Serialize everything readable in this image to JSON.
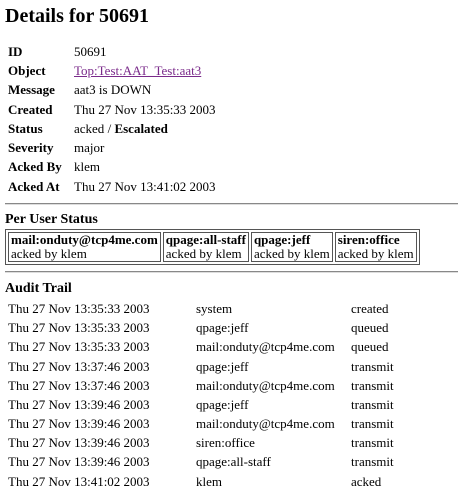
{
  "title": "Details for 50691",
  "details": [
    {
      "label": "ID",
      "value": "50691"
    },
    {
      "label": "Object",
      "value": "Top:Test:AAT_Test:aat3"
    },
    {
      "label": "Message",
      "value": "aat3 is DOWN"
    },
    {
      "label": "Created",
      "value": "Thu 27 Nov 13:35:33 2003"
    },
    {
      "label": "Status",
      "value": "acked",
      "sep": " / ",
      "extra": "Escalated"
    },
    {
      "label": "Severity",
      "value": "major"
    },
    {
      "label": "Acked By",
      "value": "klem"
    },
    {
      "label": "Acked At",
      "value": "Thu 27 Nov 13:41:02 2003"
    }
  ],
  "per_user_status": {
    "heading": "Per User Status",
    "entries": [
      {
        "user": "mail:onduty@tcp4me.com",
        "status": "acked by klem"
      },
      {
        "user": "qpage:all-staff",
        "status": "acked by klem"
      },
      {
        "user": "qpage:jeff",
        "status": "acked by klem"
      },
      {
        "user": "siren:office",
        "status": "acked by klem"
      }
    ]
  },
  "audit_trail": {
    "heading": "Audit Trail",
    "rows": [
      {
        "time": "Thu 27 Nov 13:35:33 2003",
        "who": "system",
        "action": "created"
      },
      {
        "time": "Thu 27 Nov 13:35:33 2003",
        "who": "qpage:jeff",
        "action": "queued"
      },
      {
        "time": "Thu 27 Nov 13:35:33 2003",
        "who": "mail:onduty@tcp4me.com",
        "action": "queued"
      },
      {
        "time": "Thu 27 Nov 13:37:46 2003",
        "who": "qpage:jeff",
        "action": "transmit"
      },
      {
        "time": "Thu 27 Nov 13:37:46 2003",
        "who": "mail:onduty@tcp4me.com",
        "action": "transmit"
      },
      {
        "time": "Thu 27 Nov 13:39:46 2003",
        "who": "qpage:jeff",
        "action": "transmit"
      },
      {
        "time": "Thu 27 Nov 13:39:46 2003",
        "who": "mail:onduty@tcp4me.com",
        "action": "transmit"
      },
      {
        "time": "Thu 27 Nov 13:39:46 2003",
        "who": "siren:office",
        "action": "transmit"
      },
      {
        "time": "Thu 27 Nov 13:39:46 2003",
        "who": "qpage:all-staff",
        "action": "transmit"
      },
      {
        "time": "Thu 27 Nov 13:41:02 2003",
        "who": "klem",
        "action": "acked"
      }
    ]
  },
  "colors": {
    "link": "#7a2a8a"
  }
}
